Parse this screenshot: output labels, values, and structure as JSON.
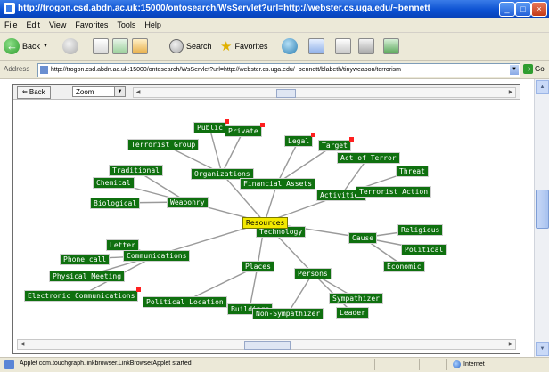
{
  "window": {
    "title": "http://trogon.csd.abdn.ac.uk:15000/ontosearch/WsServlet?url=http://webster.cs.uga.edu/~bennett",
    "controls": {
      "minimize": "_",
      "maximize": "□",
      "close": "×"
    }
  },
  "menu": [
    "File",
    "Edit",
    "View",
    "Favorites",
    "Tools",
    "Help"
  ],
  "toolbar": {
    "back": "Back",
    "search": "Search",
    "favorites": "Favorites"
  },
  "address": {
    "label": "Address",
    "value": "http://trogon.csd.abdn.ac.uk:15000/ontosearch/WsServlet?url=http://webster.cs.uga.edu/~bennett/blabeth/tinyweapon/terrorism",
    "go": "Go"
  },
  "applet": {
    "back_label": "Back",
    "zoom_value": "Zoom",
    "center_node": "Resources",
    "nodes": [
      {
        "id": "public",
        "label": "Public",
        "marker": true
      },
      {
        "id": "private",
        "label": "Private",
        "marker": true
      },
      {
        "id": "terrorist-group",
        "label": "Terrorist Group"
      },
      {
        "id": "organizations",
        "label": "Organizations"
      },
      {
        "id": "traditional",
        "label": "Traditional"
      },
      {
        "id": "chemical",
        "label": "Chemical"
      },
      {
        "id": "biological",
        "label": "Biological"
      },
      {
        "id": "weaponry",
        "label": "Weaponry"
      },
      {
        "id": "legal",
        "label": "Legal",
        "marker": true
      },
      {
        "id": "target",
        "label": "Target",
        "marker": true
      },
      {
        "id": "financial-assets",
        "label": "Financial Assets"
      },
      {
        "id": "act-of-terror",
        "label": "Act of Terror"
      },
      {
        "id": "threat",
        "label": "Threat"
      },
      {
        "id": "activities",
        "label": "Activities"
      },
      {
        "id": "terrorist-action",
        "label": "Terrorist Action"
      },
      {
        "id": "technology",
        "label": "Technology"
      },
      {
        "id": "cause",
        "label": "Cause"
      },
      {
        "id": "religious",
        "label": "Religious"
      },
      {
        "id": "political",
        "label": "Political"
      },
      {
        "id": "economic",
        "label": "Economic"
      },
      {
        "id": "letter",
        "label": "Letter"
      },
      {
        "id": "phone-call",
        "label": "Phone call"
      },
      {
        "id": "communications",
        "label": "Communications"
      },
      {
        "id": "physical-meeting",
        "label": "Physical Meeting"
      },
      {
        "id": "electronic-communications",
        "label": "Electronic Communications",
        "marker": true
      },
      {
        "id": "places",
        "label": "Places"
      },
      {
        "id": "political-location",
        "label": "Political Location"
      },
      {
        "id": "buildings",
        "label": "Buildings"
      },
      {
        "id": "persons",
        "label": "Persons"
      },
      {
        "id": "sympathizer",
        "label": "Sympathizer"
      },
      {
        "id": "non-sympathizer",
        "label": "Non-Sympathizer"
      },
      {
        "id": "leader",
        "label": "Leader"
      }
    ]
  },
  "status": {
    "text": "Applet com.touchgraph.linkbrowser.LinkBrowserApplet started",
    "zone": "Internet"
  },
  "colors": {
    "node_green": "#0f700f",
    "center_yellow": "#f2e800",
    "marker_red": "#ff2020"
  }
}
